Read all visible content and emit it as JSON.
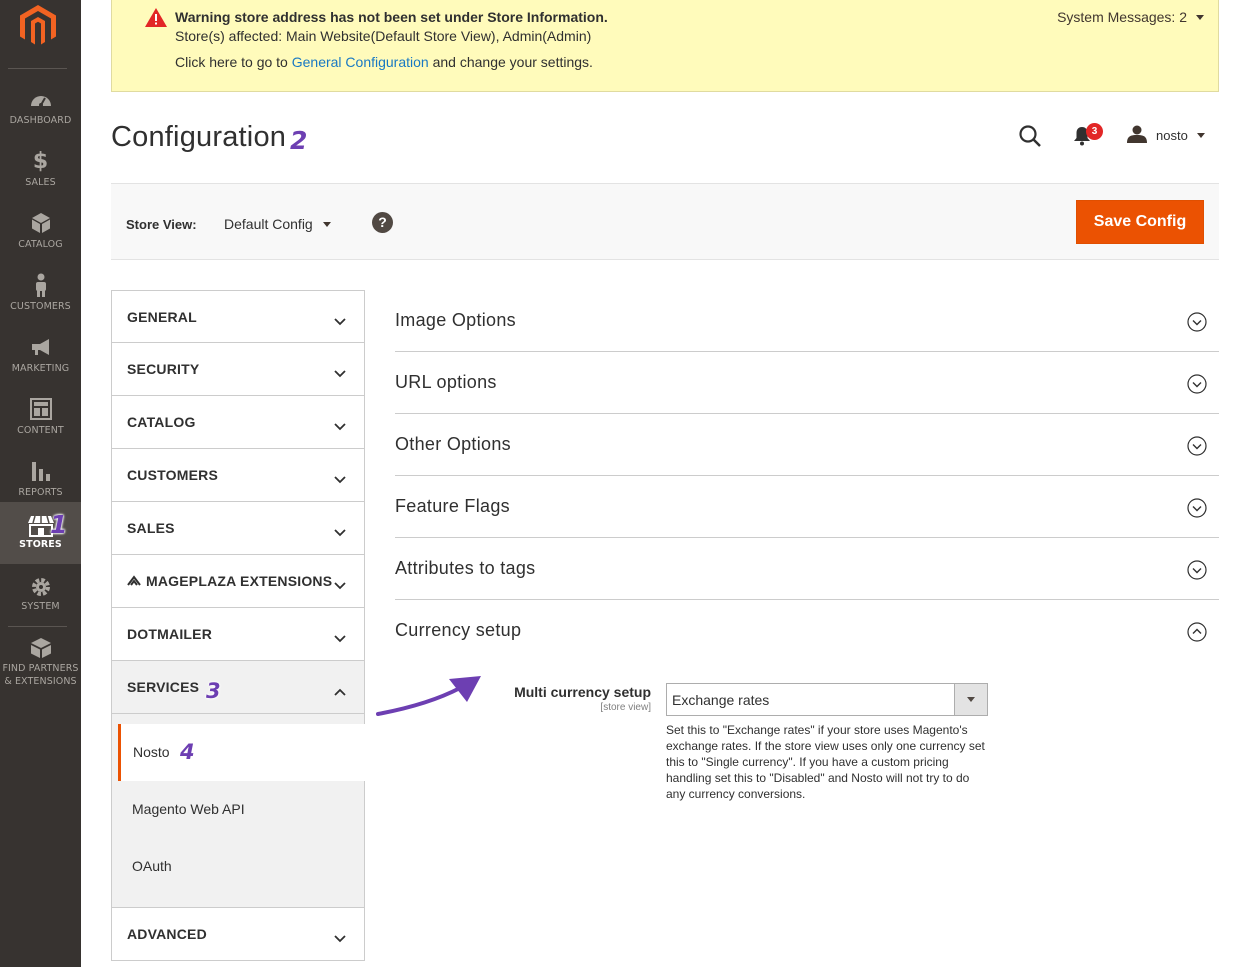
{
  "sidebar": {
    "logo_icon": "magento-logo-icon",
    "items": [
      {
        "label": "DASHBOARD",
        "icon": "dashboard-icon"
      },
      {
        "label": "SALES",
        "icon": "dollar-icon"
      },
      {
        "label": "CATALOG",
        "icon": "box-icon"
      },
      {
        "label": "CUSTOMERS",
        "icon": "person-icon"
      },
      {
        "label": "MARKETING",
        "icon": "megaphone-icon"
      },
      {
        "label": "CONTENT",
        "icon": "layout-icon"
      },
      {
        "label": "REPORTS",
        "icon": "bar-chart-icon"
      },
      {
        "label": "STORES",
        "icon": "store-icon",
        "active": true
      },
      {
        "label": "SYSTEM",
        "icon": "gear-icon"
      },
      {
        "label_line1": "FIND PARTNERS",
        "label_line2": "& EXTENSIONS",
        "icon": "blocks-icon"
      }
    ]
  },
  "annotations": {
    "step1": "1",
    "step2": "2",
    "step3": "3",
    "step4": "4"
  },
  "banner": {
    "title": "Warning store address has not been set under Store Information.",
    "affected": "Store(s) affected: Main Website(Default Store View), Admin(Admin)",
    "click_prefix": "Click here to go to",
    "link_text": "General Configuration",
    "click_suffix": "and change your settings.",
    "system_messages": "System Messages: 2"
  },
  "header": {
    "title": "Configuration",
    "notifications_count": "3",
    "username": "nosto"
  },
  "store_bar": {
    "label": "Store View:",
    "selected": "Default Config",
    "help": "?",
    "save_label": "Save Config"
  },
  "tabs": {
    "general": "GENERAL",
    "security": "SECURITY",
    "catalog": "CATALOG",
    "customers": "CUSTOMERS",
    "sales": "SALES",
    "mageplaza": "MAGEPLAZA EXTENSIONS",
    "dotmailer": "DOTMAILER",
    "services": "SERVICES",
    "services_items": [
      "Nosto",
      "Magento Web API",
      "OAuth"
    ],
    "advanced": "ADVANCED"
  },
  "sections": {
    "image_options": "Image Options",
    "url_options": "URL options",
    "other_options": "Other Options",
    "feature_flags": "Feature Flags",
    "attributes_to_tags": "Attributes to tags",
    "currency_setup": "Currency setup"
  },
  "currency_field": {
    "label": "Multi currency setup",
    "scope": "[store view]",
    "value": "Exchange rates",
    "note": "Set this to \"Exchange rates\" if your store uses Magento's exchange rates. If the store view uses only one currency set this to \"Single currency\". If you have a custom pricing handling set this to \"Disabled\" and Nosto will not try to do any currency conversions."
  },
  "colors": {
    "sidebar_bg": "#373330",
    "banner_bg": "#fffbbb",
    "accent_orange": "#eb5202",
    "link_blue": "#1979c3",
    "annotation_purple": "#6d3fb2"
  }
}
